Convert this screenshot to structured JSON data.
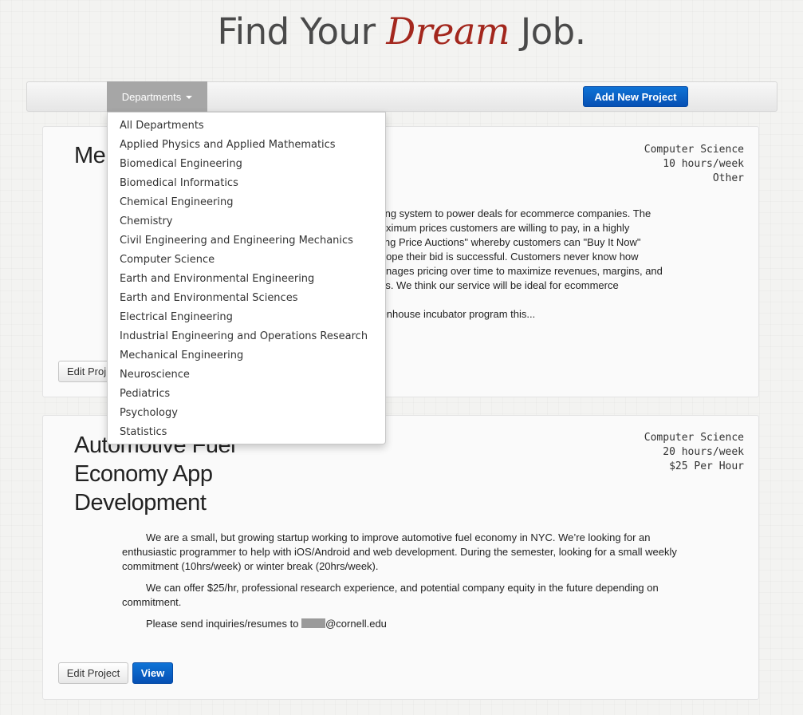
{
  "header": {
    "title_prefix": "Find Your ",
    "title_accent": "Dream",
    "title_suffix": " Job."
  },
  "navbar": {
    "departments_label": "Departments",
    "add_project_label": "Add New Project"
  },
  "dropdown": {
    "items": [
      "All Departments",
      "Applied Physics and Applied Mathematics",
      "Biomedical Engineering",
      "Biomedical Informatics",
      "Chemical Engineering",
      "Chemistry",
      "Civil Engineering and Engineering Mechanics",
      "Computer Science",
      "Earth and Environmental Engineering",
      "Earth and Environmental Sciences",
      "Electrical Engineering",
      "Industrial Engineering and Operations Research",
      "Mechanical Engineering",
      "Neuroscience",
      "Pediatrics",
      "Psychology",
      "Statistics"
    ]
  },
  "projects": [
    {
      "title_visible": "Me",
      "department": "Computer Science",
      "hours": "10 hours/week",
      "compensation": "Other",
      "desc_lines": [
        "ricing system to power deals for ecommerce companies. The",
        "maximum prices customers are willing to pay, in a highly",
        "alling Price Auctions\" whereby customers can \"Buy It Now\"",
        "d hope their bid is successful. Customers never know how",
        "manages pricing over time to maximize revenues, margins, and",
        "ilers. We think our service will be ideal for ecommerce",
        "",
        "reenhouse incubator program this..."
      ],
      "edit_label_visible": "Edit Proj"
    },
    {
      "title_lines": [
        "Automotive Fuel",
        "Economy App",
        "Development"
      ],
      "department": "Computer Science",
      "hours": "20 hours/week",
      "compensation": "$25 Per Hour",
      "paragraphs": [
        "We are a small, but growing startup working to improve automotive fuel economy in NYC. We’re looking for an enthusiastic programmer to help with iOS/Android and web development. During the semester, looking for a small weekly commitment (10hrs/week) or winter break (20hrs/week).",
        "We can offer $25/hr, professional research experience, and potential company equity in the future depending on commitment."
      ],
      "contact_prefix": "Please send inquiries/resumes to ",
      "contact_suffix": "@cornell.edu",
      "edit_label": "Edit Project",
      "view_label": "View"
    }
  ]
}
